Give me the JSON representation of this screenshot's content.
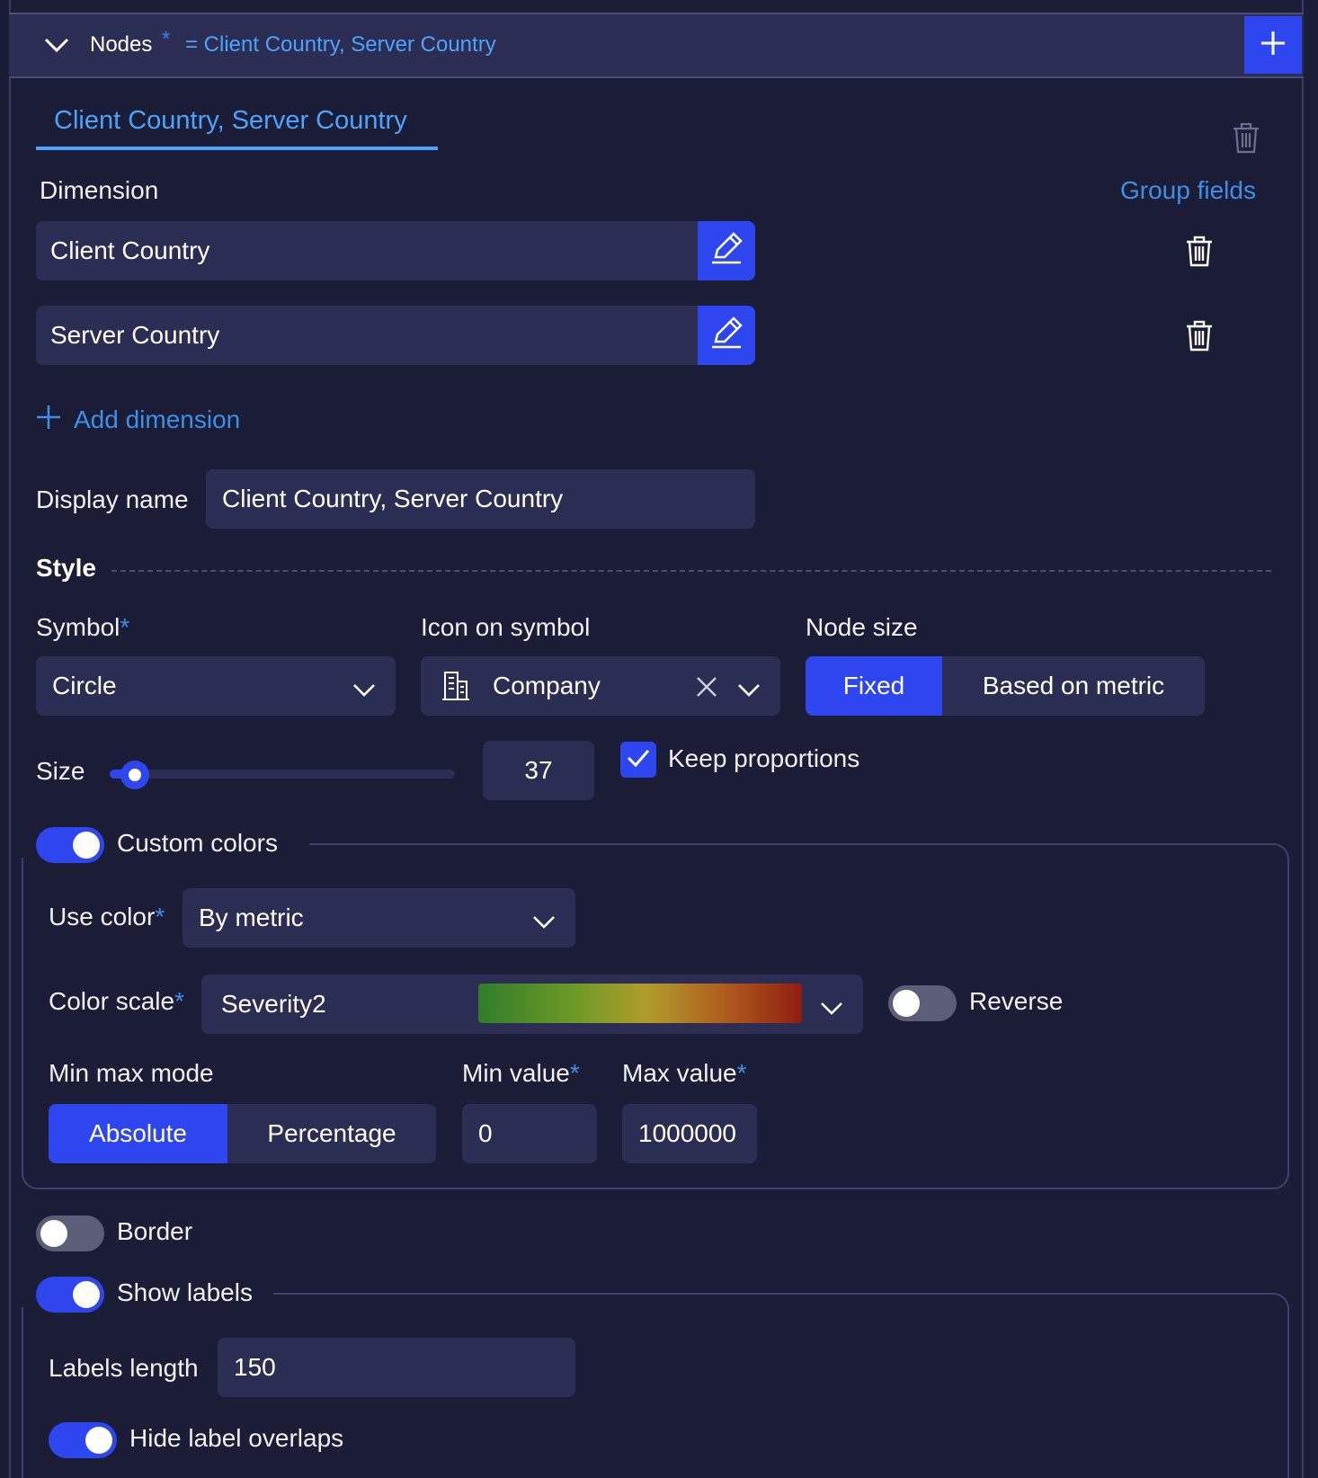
{
  "header": {
    "title": "Nodes",
    "required_mark": "*",
    "value": "= Client Country, Server Country"
  },
  "tab": {
    "label": "Client Country, Server Country"
  },
  "dimension": {
    "label": "Dimension",
    "group_fields": "Group fields",
    "items": [
      {
        "label": "Client Country"
      },
      {
        "label": "Server Country"
      }
    ],
    "add_label": "Add dimension"
  },
  "display_name": {
    "label": "Display name",
    "value": "Client Country, Server Country"
  },
  "style": {
    "heading": "Style",
    "symbol": {
      "label": "Symbol",
      "value": "Circle"
    },
    "icon_on_symbol": {
      "label": "Icon on symbol",
      "value": "Company"
    },
    "node_size": {
      "label": "Node size",
      "options": [
        "Fixed",
        "Based on metric"
      ],
      "selected": "Fixed"
    },
    "size": {
      "label": "Size",
      "value": "37",
      "slider_fraction": 0.07
    },
    "keep_proportions": {
      "label": "Keep proportions",
      "checked": true
    }
  },
  "custom_colors": {
    "label": "Custom colors",
    "enabled": true,
    "use_color": {
      "label": "Use color",
      "value": "By metric"
    },
    "color_scale": {
      "label": "Color scale",
      "value": "Severity2",
      "colors": [
        "#2f7d2a",
        "#6e9a26",
        "#b09c2a",
        "#b0601e",
        "#901c10"
      ]
    },
    "reverse": {
      "label": "Reverse",
      "enabled": false
    },
    "min_max_mode": {
      "label": "Min max mode",
      "options": [
        "Absolute",
        "Percentage"
      ],
      "selected": "Absolute"
    },
    "min_value": {
      "label": "Min value",
      "value": "0"
    },
    "max_value": {
      "label": "Max value",
      "value": "1000000"
    }
  },
  "border": {
    "label": "Border",
    "enabled": false
  },
  "labels": {
    "label": "Show labels",
    "enabled": true,
    "length": {
      "label": "Labels length",
      "value": "150"
    },
    "hide_overlaps": {
      "label": "Hide label overlaps",
      "enabled": true
    }
  },
  "colors": {
    "accent": "#2e46f0",
    "link": "#4aa3ff",
    "field": "#2c2d52",
    "background": "#1b1c36"
  }
}
